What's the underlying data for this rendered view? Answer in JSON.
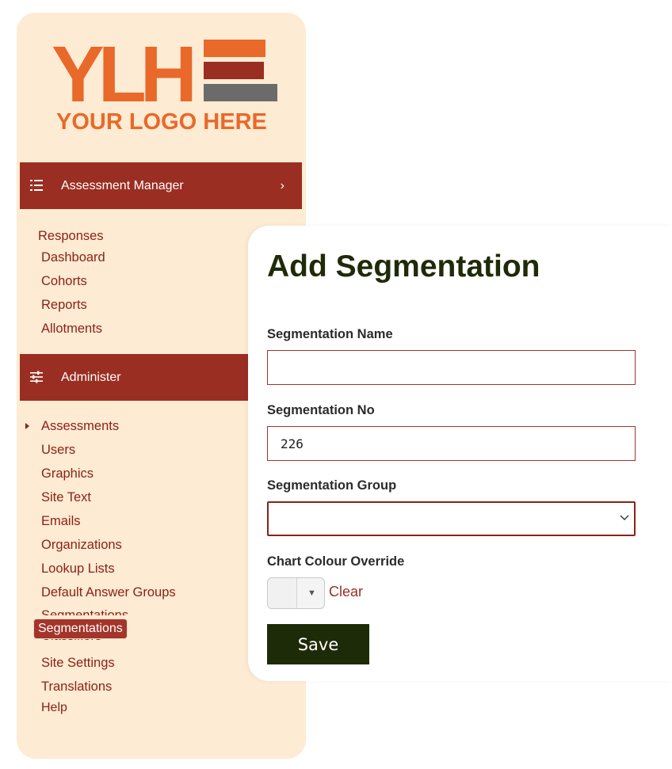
{
  "logo": {
    "letters": "YLH",
    "tagline": "YOUR LOGO HERE",
    "colors": {
      "primary": "#e8692a",
      "bar_dark_red": "#9a2e22",
      "bar_grey": "#6b6b6b"
    }
  },
  "sidebar": {
    "assessment_manager": {
      "label": "Assessment Manager",
      "icon": "list-icon",
      "chevron": "›"
    },
    "assessment_items": [
      "Responses",
      "Dashboard",
      "Cohorts",
      "Reports",
      "Allotments"
    ],
    "administer": {
      "label": "Administer",
      "icon": "sliders-icon"
    },
    "admin_items": [
      "Assessments",
      "Users",
      "Graphics",
      "Site Text",
      "Emails",
      "Organizations",
      "Lookup Lists",
      "Default Answer Groups"
    ],
    "segmentations_partial": "Segmentations",
    "classifiers_partial": "Classifiers",
    "more_items": [
      "Site Settings",
      "Translations",
      "Help"
    ],
    "tooltip": "Segmentations"
  },
  "form": {
    "title": "Add Segmentation",
    "name_label": "Segmentation Name",
    "name_value": "",
    "no_label": "Segmentation No",
    "no_value": "226",
    "group_label": "Segmentation Group",
    "group_value": "",
    "colour_label": "Chart Colour Override",
    "clear_label": "Clear",
    "save_label": "Save"
  },
  "colors": {
    "sidebar_bg": "#fdebd3",
    "header_bg": "#9a2e22",
    "link": "#8b2218",
    "title": "#1f2b08",
    "save_bg": "#1e2b08"
  }
}
